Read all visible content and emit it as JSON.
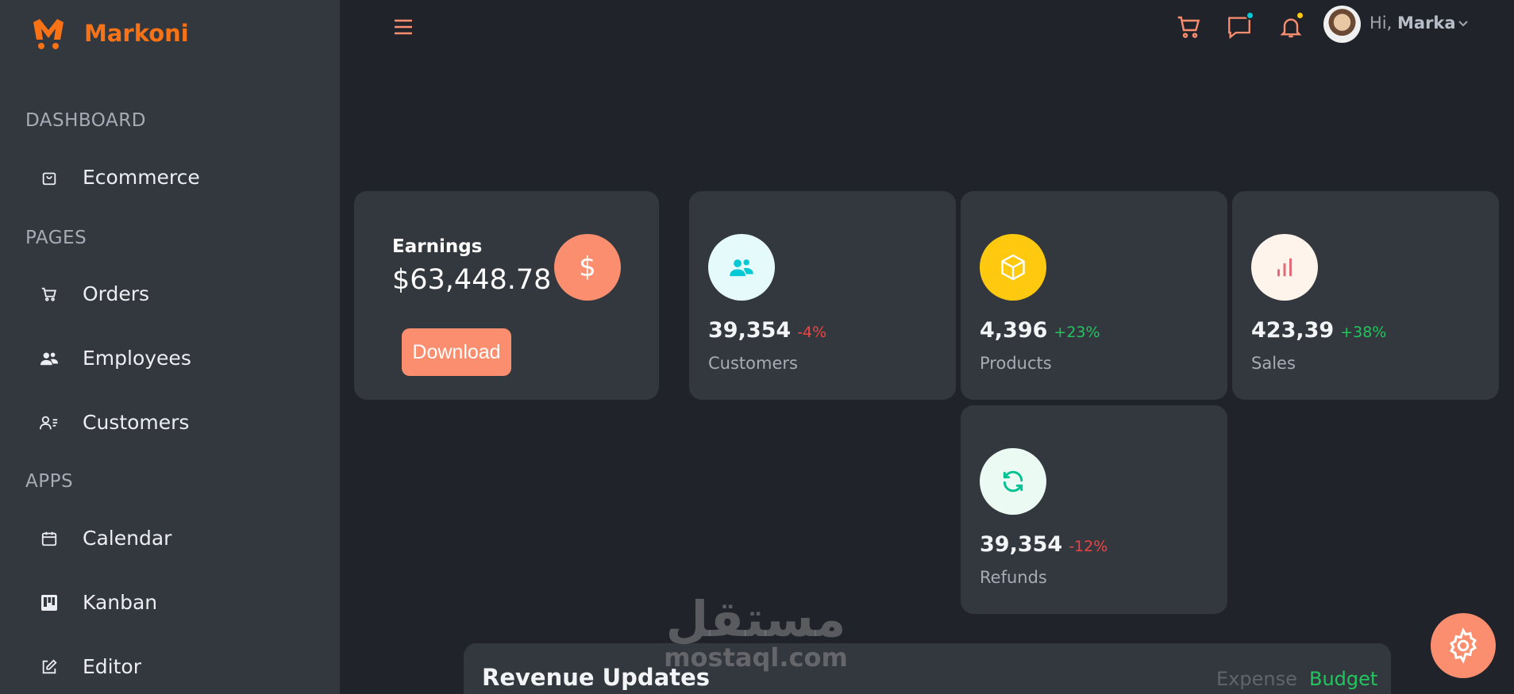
{
  "brand": {
    "name": "Markoni",
    "accent": "#f97316"
  },
  "sidebar": {
    "sections": [
      {
        "title": "DASHBOARD",
        "items": [
          {
            "label": "Ecommerce",
            "icon": "shopping-bag-icon"
          }
        ]
      },
      {
        "title": "PAGES",
        "items": [
          {
            "label": "Orders",
            "icon": "cart-icon"
          },
          {
            "label": "Employees",
            "icon": "people-icon"
          },
          {
            "label": "Customers",
            "icon": "user-list-icon"
          }
        ]
      },
      {
        "title": "APPS",
        "items": [
          {
            "label": "Calendar",
            "icon": "calendar-icon"
          },
          {
            "label": "Kanban",
            "icon": "kanban-icon"
          },
          {
            "label": "Editor",
            "icon": "edit-icon"
          }
        ]
      }
    ]
  },
  "topbar": {
    "greeting": "Hi,",
    "user_name": "Marka",
    "chat_dot_color": "#03c9d7",
    "bell_dot_color": "#fec90f"
  },
  "earnings": {
    "title": "Earnings",
    "value": "$63,448.78",
    "currency_symbol": "$",
    "button": "Download"
  },
  "stats": [
    {
      "value": "39,354",
      "change": "-4%",
      "label": "Customers",
      "change_color": "#ef4444",
      "icon": "customers-icon",
      "icon_bg": "#e5fafb",
      "icon_color": "#03c9d7"
    },
    {
      "value": "4,396",
      "change": "+23%",
      "label": "Products",
      "change_color": "#22c55e",
      "icon": "box-icon",
      "icon_bg": "#fec90f",
      "icon_color": "#ffffff"
    },
    {
      "value": "423,39",
      "change": "+38%",
      "label": "Sales",
      "change_color": "#22c55e",
      "icon": "bar-chart-icon",
      "icon_bg": "#fff4ec",
      "icon_color": "#e46a76"
    },
    {
      "value": "39,354",
      "change": "-12%",
      "label": "Refunds",
      "change_color": "#ef4444",
      "icon": "refresh-icon",
      "icon_bg": "#ebfaf2",
      "icon_color": "#00c292"
    }
  ],
  "revenue": {
    "title": "Revenue Updates",
    "legend_expense": "Expense",
    "legend_budget": "Budget"
  },
  "watermark": {
    "arabic": "مستقل",
    "latin": "mostaql.com"
  }
}
